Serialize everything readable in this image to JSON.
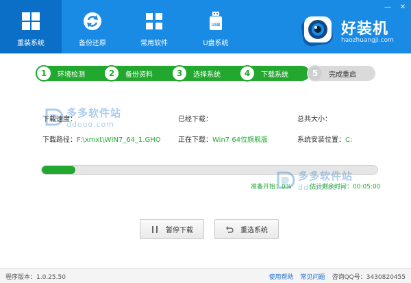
{
  "nav": [
    {
      "label": "重装系统",
      "icon": "windows-icon",
      "active": true
    },
    {
      "label": "备份还原",
      "icon": "refresh-icon"
    },
    {
      "label": "常用软件",
      "icon": "apps-grid-icon"
    },
    {
      "label": "U盘系统",
      "icon": "usb-drive-icon"
    }
  ],
  "usb_icon_text": "USB",
  "brand": {
    "name": "好装机",
    "url": "haozhuangji.com"
  },
  "window_controls": {
    "minimize": "—",
    "close": "✕"
  },
  "steps": [
    {
      "num": "1",
      "label": "环境检测",
      "state": "done"
    },
    {
      "num": "2",
      "label": "备份资料",
      "state": "done"
    },
    {
      "num": "3",
      "label": "选择系统",
      "state": "done"
    },
    {
      "num": "4",
      "label": "下载系统",
      "state": "current"
    },
    {
      "num": "5",
      "label": "完成重启",
      "state": "pending"
    }
  ],
  "download": {
    "speed_label": "下载速度：",
    "downloaded_label": "已经下载：",
    "total_size_label": "总共大小：",
    "path_label": "下载路径：",
    "path_value": "F:\\xmxt\\WIN7_64_1.GHO",
    "current_label": "正在下载：",
    "current_value": "Win7 64位旗舰版",
    "install_loc_label": "系统安装位置：",
    "install_loc_value": "C:"
  },
  "progress": {
    "percent": 0.1,
    "status_label": "准备开始：",
    "status_value": "0%",
    "time_label": "估计剩余时间：",
    "time_value": "00:05:00"
  },
  "buttons": {
    "pause": "暂停下载",
    "reselect": "重选系统"
  },
  "watermark": {
    "cn": "多多软件站",
    "en": "ddooo.com"
  },
  "footer": {
    "version": "程序版本：1.0.25.50",
    "help": "使用帮助",
    "faq": "常见问题",
    "qq": "咨询QQ号：3430820455"
  },
  "colors": {
    "header": "#1a8be4",
    "active_nav": "#0b6fc8",
    "green": "#22a82e",
    "gray_step": "#dadada"
  }
}
